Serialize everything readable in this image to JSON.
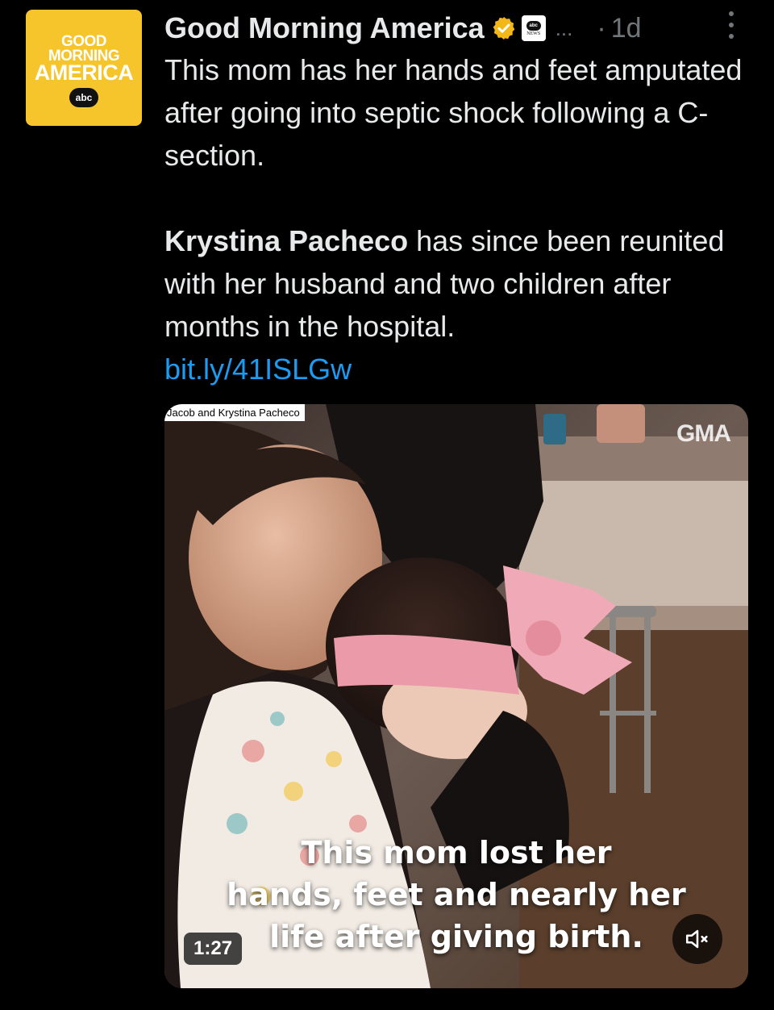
{
  "author": {
    "avatar_lines": [
      "GOOD",
      "MORNING",
      "AMERICA"
    ],
    "avatar_badge": "abc",
    "name": "Good Morning America",
    "affiliate_badge_top": "abc",
    "affiliate_badge_bottom": "NEWS",
    "ellipsis": "...",
    "separator": "·",
    "timestamp": "1d"
  },
  "tweet": {
    "para1": "This mom has her hands and feet amputated after going into septic shock following a C-section.",
    "para2_bold": "Krystina Pacheco",
    "para2_rest": " has since been reunited with her husband and two children after months in the hospital.",
    "link": "bit.ly/41ISLGw"
  },
  "media": {
    "credit": "Jacob and Krystina Pacheco",
    "watermark": "GMA",
    "caption_lines": [
      "This mom lost her",
      "hands, feet and nearly her",
      "life after giving birth."
    ],
    "duration": "1:27"
  },
  "colors": {
    "background": "#000000",
    "text": "#e7e9ea",
    "muted": "#71767b",
    "link": "#1d9bf0",
    "verified": "#f4b718",
    "avatar_bg": "#f6c52c"
  }
}
